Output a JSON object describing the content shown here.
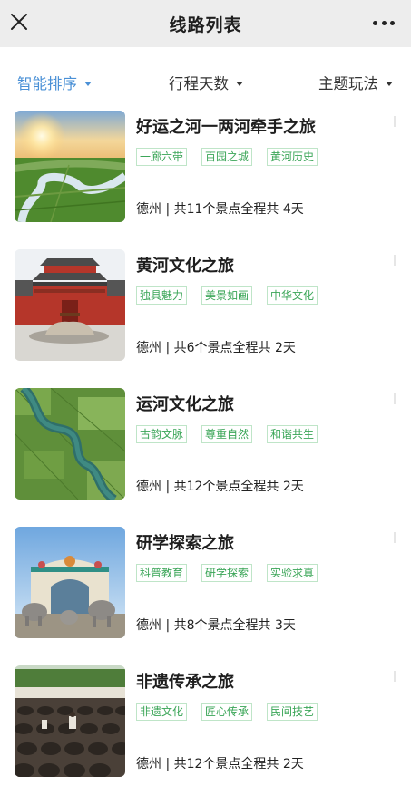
{
  "navbar": {
    "title": "线路列表"
  },
  "filters": {
    "smart": "智能排序",
    "days": "行程天数",
    "theme": "主题玩法"
  },
  "routes": [
    {
      "title": "好运之河一两河牵手之旅",
      "tags": [
        "一廊六带",
        "百园之城",
        "黄河历史"
      ],
      "info": "德州 | 共11个景点全程共 4天",
      "thumb": "river-sunset"
    },
    {
      "title": "黄河文化之旅",
      "tags": [
        "独具魅力",
        "美景如画",
        "中华文化"
      ],
      "info": "德州 | 共6个景点全程共 2天",
      "thumb": "chinese-gate"
    },
    {
      "title": "运河文化之旅",
      "tags": [
        "古韵文脉",
        "尊重自然",
        "和谐共生"
      ],
      "info": "德州 | 共12个景点全程共 2天",
      "thumb": "canal-fields"
    },
    {
      "title": "研学探索之旅",
      "tags": [
        "科普教育",
        "研学探索",
        "实验求真"
      ],
      "info": "德州 | 共8个景点全程共 3天",
      "thumb": "elephant-park"
    },
    {
      "title": "非遗传承之旅",
      "tags": [
        "非遗文化",
        "匠心传承",
        "民间技艺"
      ],
      "info": "德州 | 共12个景点全程共 2天",
      "thumb": "pottery-jars"
    }
  ]
}
